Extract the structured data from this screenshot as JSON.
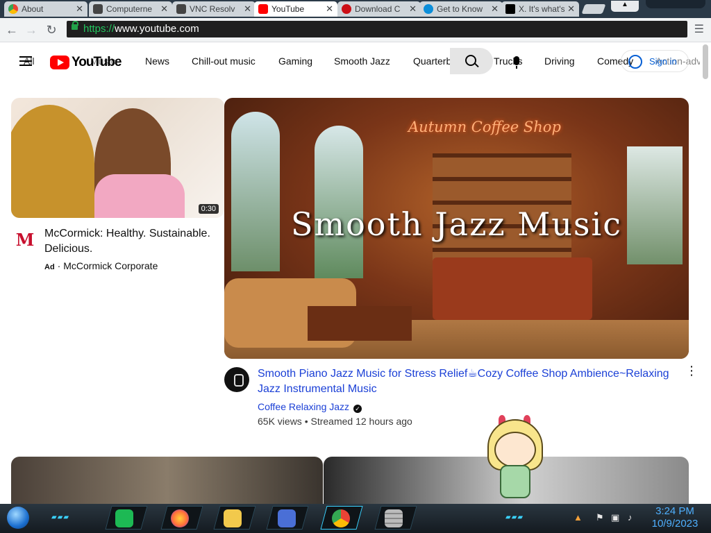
{
  "browser": {
    "tabs": [
      {
        "title": "About",
        "color": "#4285f4",
        "active": false
      },
      {
        "title": "Computerne",
        "color": "#444444",
        "active": false
      },
      {
        "title": "VNC Resolv",
        "color": "#444444",
        "active": false
      },
      {
        "title": "YouTube",
        "color": "#ff0000",
        "active": true
      },
      {
        "title": "Download C",
        "color": "#cc0f16",
        "active": false
      },
      {
        "title": "Get to Know",
        "color": "#0c8ed9",
        "active": false
      },
      {
        "title": "X. It's what's",
        "color": "#000000",
        "active": false
      }
    ],
    "url_scheme": "https://",
    "url_host": "www.youtube.com"
  },
  "youtube": {
    "logo_text": "YouTube",
    "chips": [
      "All",
      "Music",
      "News",
      "Chill-out music",
      "Gaming",
      "Smooth Jazz",
      "Quarterb",
      "Trucks",
      "Driving",
      "Comedy",
      "Action-adv"
    ],
    "sign_in_label": "Sign in"
  },
  "ad": {
    "duration": "0:30",
    "logo_letter": "M",
    "title": "McCormick: Healthy. Sustainable. Delicious.",
    "ad_tag": "Ad",
    "advertiser": "· McCormick Corporate"
  },
  "video": {
    "thumb_sign": "Autumn Coffee Shop",
    "thumb_overlay": "Smooth Jazz Music",
    "title": "Smooth Piano Jazz Music for Stress Relief☕Cozy Coffee Shop Ambience~Relaxing Jazz Instrumental Music",
    "channel": "Coffee Relaxing Jazz",
    "verified_mark": "✓",
    "views": "65K views",
    "age": "Streamed 12 hours ago",
    "meta_sep": " • "
  },
  "taskbar": {
    "time": "3:24 PM",
    "date": "10/9/2023",
    "apps": [
      {
        "name": "spotify",
        "color": "#1db954"
      },
      {
        "name": "firefox",
        "color": "#ff7139"
      },
      {
        "name": "file-explorer",
        "color": "#f2c94c"
      },
      {
        "name": "network-card",
        "color": "#4a6fd6"
      },
      {
        "name": "chrome",
        "color": "#4285f4"
      },
      {
        "name": "bricks",
        "color": "#bbbbbb"
      }
    ]
  }
}
